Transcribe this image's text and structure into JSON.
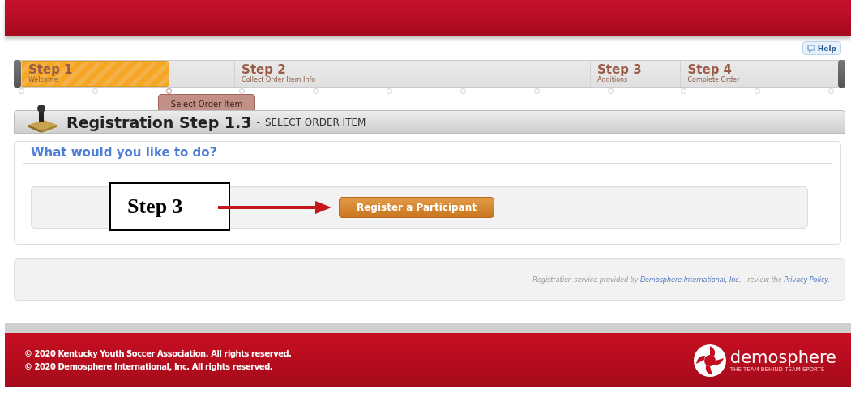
{
  "help_button": "Help",
  "steps": [
    {
      "title": "Step 1",
      "subtitle": "Welcome"
    },
    {
      "title": "Step 2",
      "subtitle": "Collect Order Item Info"
    },
    {
      "title": "Step 3",
      "subtitle": "Additions"
    },
    {
      "title": "Step 4",
      "subtitle": "Complete Order"
    }
  ],
  "progress": {
    "level": 0.18
  },
  "markers": [
    {
      "selected": false
    },
    {
      "selected": false
    },
    {
      "selected": true
    },
    {
      "selected": false
    },
    {
      "selected": false
    },
    {
      "selected": false
    },
    {
      "selected": false
    },
    {
      "selected": false
    },
    {
      "selected": false
    },
    {
      "selected": false
    },
    {
      "selected": false
    },
    {
      "selected": false
    }
  ],
  "tooltip": "Select Order Item",
  "page_heading": {
    "title": "Registration Step 1.3",
    "separator": "-",
    "subtitle": "SELECT ORDER ITEM"
  },
  "question": "What would you like to do?",
  "annotation": "Step 3",
  "action_button": "Register a Participant",
  "service_note": {
    "text": "Registration service provided by",
    "company_link": "Demosphere International, Inc.",
    "middle": "- review the",
    "policy_link": "Privacy Policy",
    "end": "."
  },
  "footer": {
    "lines": [
      "© 2020 Kentucky Youth Soccer Association. All rights reserved.",
      "© 2020 Demosphere International, Inc. All rights reserved."
    ],
    "logo_name": "demosphere",
    "logo_tagline": "THE TEAM BEHIND TEAM SPORTS"
  }
}
